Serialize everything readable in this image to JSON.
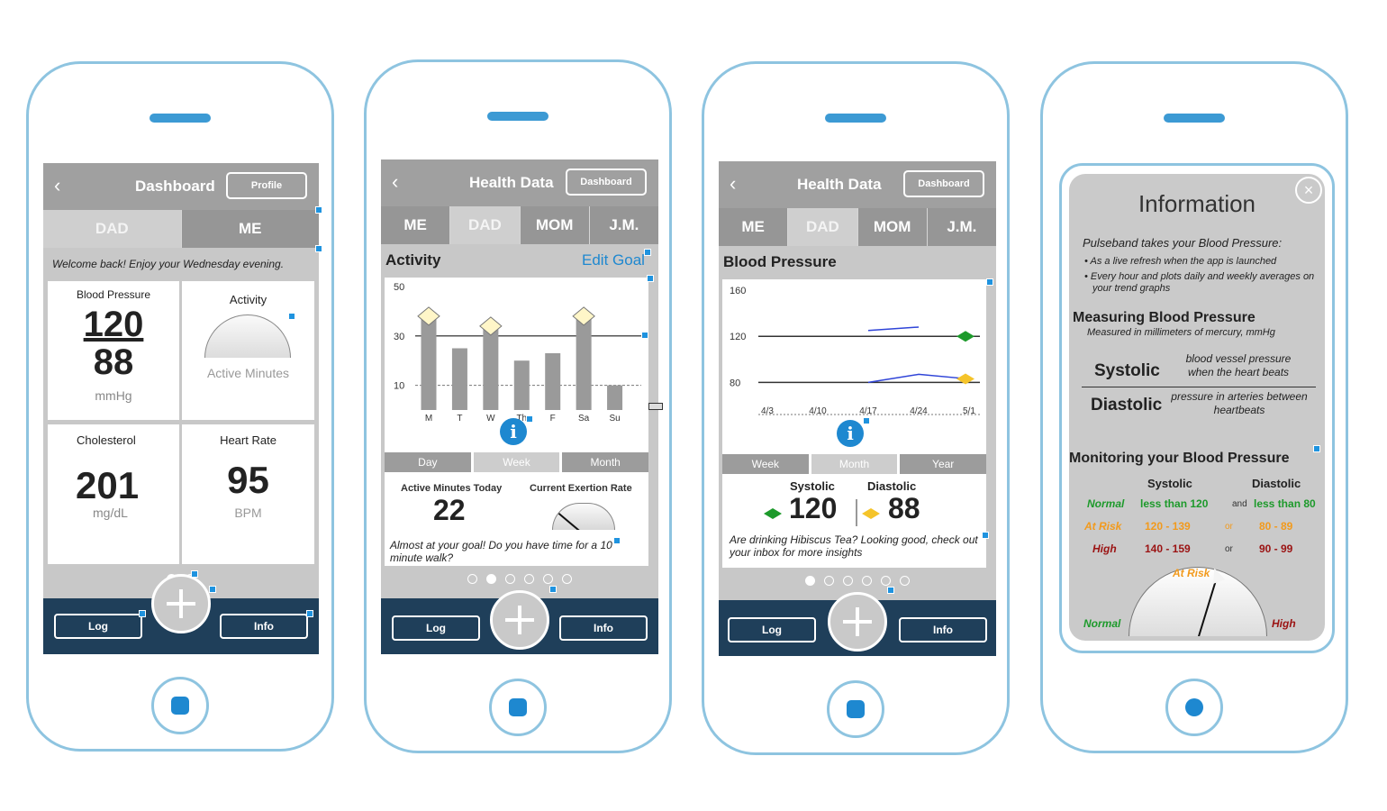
{
  "phone1": {
    "header": {
      "title": "Dashboard",
      "button": "Profile"
    },
    "tabs": [
      "DAD",
      "ME"
    ],
    "welcome": "Welcome back! Enjoy your Wednesday evening.",
    "bp": {
      "label": "Blood Pressure",
      "systolic": "120",
      "diastolic": "88",
      "unit": "mmHg"
    },
    "activity": {
      "label": "Activity",
      "sub": "Active Minutes"
    },
    "cholesterol": {
      "label": "Cholesterol",
      "value": "201",
      "unit": "mg/dL"
    },
    "heart": {
      "label": "Heart Rate",
      "value": "95",
      "unit": "BPM"
    },
    "nav": {
      "log": "Log",
      "info": "Info"
    }
  },
  "phone2": {
    "header": {
      "title": "Health Data",
      "button": "Dashboard"
    },
    "tabs": [
      "ME",
      "DAD",
      "MOM",
      "J.M."
    ],
    "section": "Activity",
    "edit_goal": "Edit Goal",
    "segments": [
      "Day",
      "Week",
      "Month"
    ],
    "active_label": "Active Minutes Today",
    "active_value": "22",
    "exertion_label": "Current Exertion Rate",
    "message": "Almost at your goal! Do you have time for a 10 minute walk?",
    "nav": {
      "log": "Log",
      "info": "Info"
    }
  },
  "phone3": {
    "header": {
      "title": "Health Data",
      "button": "Dashboard"
    },
    "tabs": [
      "ME",
      "DAD",
      "MOM",
      "J.M."
    ],
    "section": "Blood Pressure",
    "segments": [
      "Week",
      "Month",
      "Year"
    ],
    "systolic_label": "Systolic",
    "systolic_value": "120",
    "diastolic_label": "Diastolic",
    "diastolic_value": "88",
    "message": "Are drinking Hibiscus Tea? Looking good, check out your inbox for more insights",
    "nav": {
      "log": "Log",
      "info": "Info"
    }
  },
  "phone4": {
    "title": "Information",
    "intro": "Pulseband takes your Blood Pressure:",
    "bullets": [
      "As a live refresh when the app is launched",
      "Every hour and plots daily and weekly averages on your trend graphs"
    ],
    "measuring_title": "Measuring Blood Pressure",
    "measuring_sub": "Measured in millimeters of mercury, mmHg",
    "systolic": "Systolic",
    "systolic_desc": "blood vessel pressure when the heart beats",
    "diastolic": "Diastolic",
    "diastolic_desc": "pressure in arteries between heartbeats",
    "monitoring_title": "Monitoring your Blood Pressure",
    "col_systolic": "Systolic",
    "col_diastolic": "Diastolic",
    "rows": [
      {
        "name": "Normal",
        "sys": "less than 120",
        "join": "and",
        "dia": "less than 80"
      },
      {
        "name": "At Risk",
        "sys": "120 - 139",
        "join": "or",
        "dia": "80 - 89"
      },
      {
        "name": "High",
        "sys": "140 - 159",
        "join": "or",
        "dia": "90 - 99"
      }
    ],
    "gauge": {
      "left": "Normal",
      "top": "At Risk",
      "right": "High"
    }
  },
  "chart_data": [
    {
      "type": "bar",
      "categories": [
        "M",
        "T",
        "W",
        "Th",
        "F",
        "Sa",
        "Su"
      ],
      "values": [
        38,
        25,
        34,
        20,
        23,
        38,
        10
      ],
      "goal_markers": [
        "M",
        "W",
        "Sa"
      ],
      "goal_line": 30,
      "reference_line": 10,
      "ylim": [
        0,
        50
      ],
      "yticks": [
        10,
        30,
        50
      ],
      "colors": {
        "bar": "#9a9a9a",
        "marker": "#fff6c8"
      }
    },
    {
      "type": "line",
      "x": [
        "4/3",
        "4/10",
        "4/17",
        "4/24",
        "5/1"
      ],
      "series": [
        {
          "values": [
            null,
            null,
            125,
            128,
            null
          ],
          "color": "#2f44d8"
        },
        {
          "values": [
            null,
            null,
            80,
            87,
            83
          ],
          "color": "#2f44d8"
        }
      ],
      "reference_lines": [
        120,
        80
      ],
      "markers": [
        {
          "x": "5/1",
          "y": 120,
          "color": "#1d9a2b"
        },
        {
          "x": "5/1",
          "y": 83,
          "color": "#f5c42a"
        }
      ],
      "ylim": [
        60,
        160
      ],
      "yticks": [
        80,
        120,
        160
      ]
    }
  ],
  "colors": {
    "accent": "#1e88d0",
    "nav": "#1f3f5a",
    "normal": "#1d9a2b",
    "risk": "#f29a1c",
    "high": "#9b1313"
  }
}
